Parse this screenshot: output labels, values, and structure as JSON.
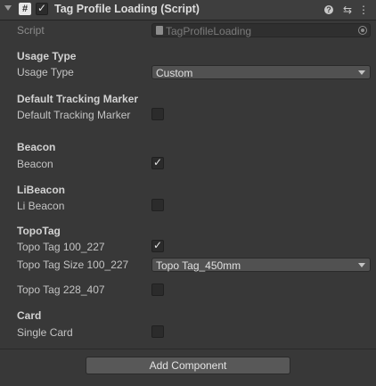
{
  "header": {
    "title": "Tag Profile Loading (Script)",
    "enabled": true,
    "script_icon": "#",
    "help_icon": "?",
    "presets_icon": "⇆",
    "menu_icon": "⋮"
  },
  "script_field": {
    "label": "Script",
    "value": "TagProfileLoading"
  },
  "usage_type": {
    "section": "Usage Type",
    "label": "Usage Type",
    "value": "Custom"
  },
  "default_tracking_marker": {
    "section": "Default Tracking Marker",
    "label": "Default Tracking Marker",
    "checked": false
  },
  "beacon": {
    "section": "Beacon",
    "label": "Beacon",
    "checked": true
  },
  "libeacon": {
    "section": "LiBeacon",
    "label": "Li Beacon",
    "checked": false
  },
  "topotag": {
    "section": "TopoTag",
    "tag_100_227": {
      "label": "Topo Tag 100_227",
      "checked": true
    },
    "size_100_227": {
      "label": "Topo Tag Size 100_227",
      "value": "Topo Tag_450mm"
    },
    "tag_228_407": {
      "label": "Topo Tag 228_407",
      "checked": false
    }
  },
  "card": {
    "section": "Card",
    "label": "Single Card",
    "checked": false
  },
  "footer": {
    "add_component": "Add Component"
  },
  "check_glyph": "✓"
}
